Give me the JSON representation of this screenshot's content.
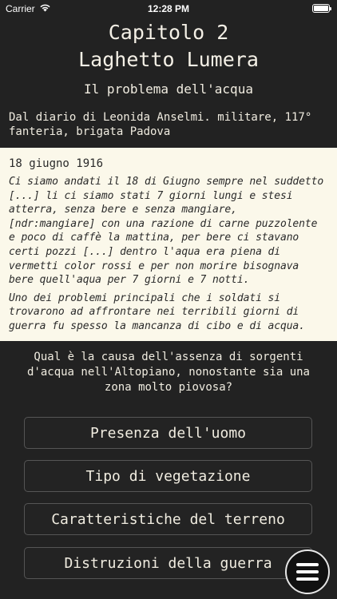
{
  "status": {
    "carrier": "Carrier",
    "time": "12:28 PM"
  },
  "header": {
    "chapter": "Capitolo 2",
    "place": "Laghetto Lumera",
    "subtitle": "Il problema dell'acqua"
  },
  "intro": "Dal diario di Leonida Anselmi. militare, 117° fanteria, brigata Padova",
  "diary": {
    "date": "18 giugno 1916",
    "quote": "Ci siamo andati il 18 di Giugno sempre nel suddetto [...] li ci siamo stati 7 giorni lungi e stesi atterra, senza bere e senza mangiare, [ndr:mangiare] con una razione di carne puzzolente e poco di caffè la mattina, per bere ci stavano certi pozzi [...] dentro l'aqua era piena di vermetti color rossi e per non morire bisognava bere quell'aqua per 7 giorni e 7 notti.",
    "note": "Uno dei problemi principali che i soldati si trovarono ad affrontare nei terribili giorni di guerra fu spesso la mancanza di cibo e di acqua."
  },
  "question": "Qual è la causa dell'assenza di sorgenti d'acqua nell'Altopiano, nonostante sia una zona molto piovosa?",
  "answers": [
    "Presenza dell'uomo",
    "Tipo di vegetazione",
    "Caratteristiche del terreno",
    "Distruzioni della guerra"
  ],
  "icons": {
    "wifi": "wifi-icon",
    "battery": "battery-icon",
    "menu": "hamburger-menu-icon"
  },
  "colors": {
    "background": "#222222",
    "diary_bg": "#fbf8ea",
    "text": "#f0ece0",
    "button_border": "#555555"
  }
}
